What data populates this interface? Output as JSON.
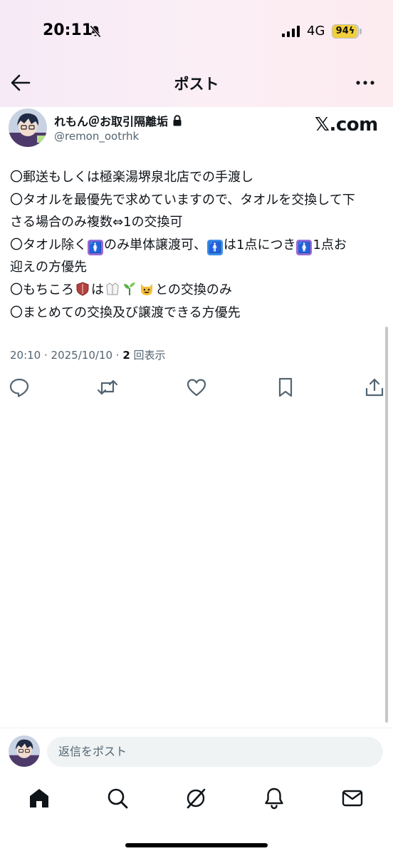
{
  "status_bar": {
    "time": "20:11",
    "network": "4G",
    "battery_level": "94",
    "battery_percent": 94
  },
  "nav": {
    "title": "ポスト"
  },
  "post": {
    "display_name": "れもん＠お取引隔離垢",
    "handle": "@remon_ootrhk",
    "source_label": "𝕏.com",
    "lines": {
      "l1": "〇郵送もしくは極楽湯堺泉北店での手渡し",
      "l2": "〇タオルを最優先で求めていますので、タオルを交換して下",
      "l3": "さる場合のみ複数⇔1の交換可",
      "l4a": "〇タオル除く",
      "l4b": "のみ単体譲渡可、",
      "l4c": "は1点につき",
      "l4d": "1点お",
      "l5": "迎えの方優先",
      "l6a": "〇もちころ",
      "l6b": "は",
      "l6c": "との交換のみ",
      "l7": "〇まとめての交換及び譲渡できる方優先"
    },
    "time": "20:10",
    "date": "2025/10/10",
    "view_count": "2",
    "view_label": "回表示"
  },
  "reply": {
    "placeholder": "返信をポスト"
  },
  "icons": {
    "female_sign": "🚺",
    "male_sign": "🚹",
    "accent_purple": "#9b6bd4",
    "accent_blue": "#3b8ee8"
  }
}
